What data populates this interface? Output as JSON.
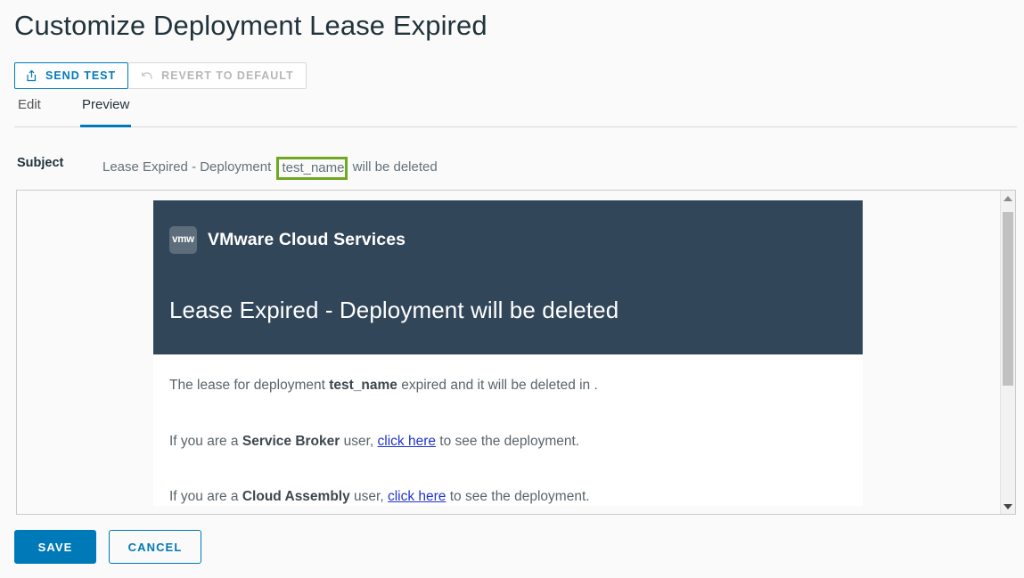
{
  "page": {
    "title": "Customize Deployment Lease Expired"
  },
  "toolbar": {
    "send_test_label": "Send Test",
    "send_test_icon": "export-icon",
    "revert_label": "Revert to Default",
    "revert_icon": "undo-icon"
  },
  "tabs": [
    {
      "label": "Edit",
      "active": false
    },
    {
      "label": "Preview",
      "active": true
    }
  ],
  "subject": {
    "label": "Subject",
    "before": "Lease Expired - Deployment ",
    "token": "test_name",
    "after": " will be deleted",
    "token_highlight_color": "#6fa821"
  },
  "email": {
    "logo_text": "vmw",
    "brand": "VMware Cloud Services",
    "heading": "Lease Expired - Deployment will be deleted",
    "header_bg": "#32465a",
    "paragraphs": [
      {
        "p1": "The lease for deployment ",
        "bold1": "test_name",
        "p2": " expired and it will be deleted in ."
      },
      {
        "p1": "If you are a ",
        "bold1": "Service Broker",
        "p2": " user, ",
        "link": "click here",
        "p3": " to see the deployment."
      },
      {
        "p1": "If you are a ",
        "bold1": "Cloud Assembly",
        "p2": " user, ",
        "link": "click here",
        "p3": " to see the deployment."
      }
    ]
  },
  "scrollbar": {
    "up_icon": "chevron-up-icon",
    "down_icon": "chevron-down-icon"
  },
  "footer": {
    "save_label": "Save",
    "cancel_label": "Cancel"
  },
  "colors": {
    "accent": "#0079b8",
    "header_dark": "#32465a",
    "link": "#1f35cd",
    "highlight_green": "#6fa821"
  }
}
